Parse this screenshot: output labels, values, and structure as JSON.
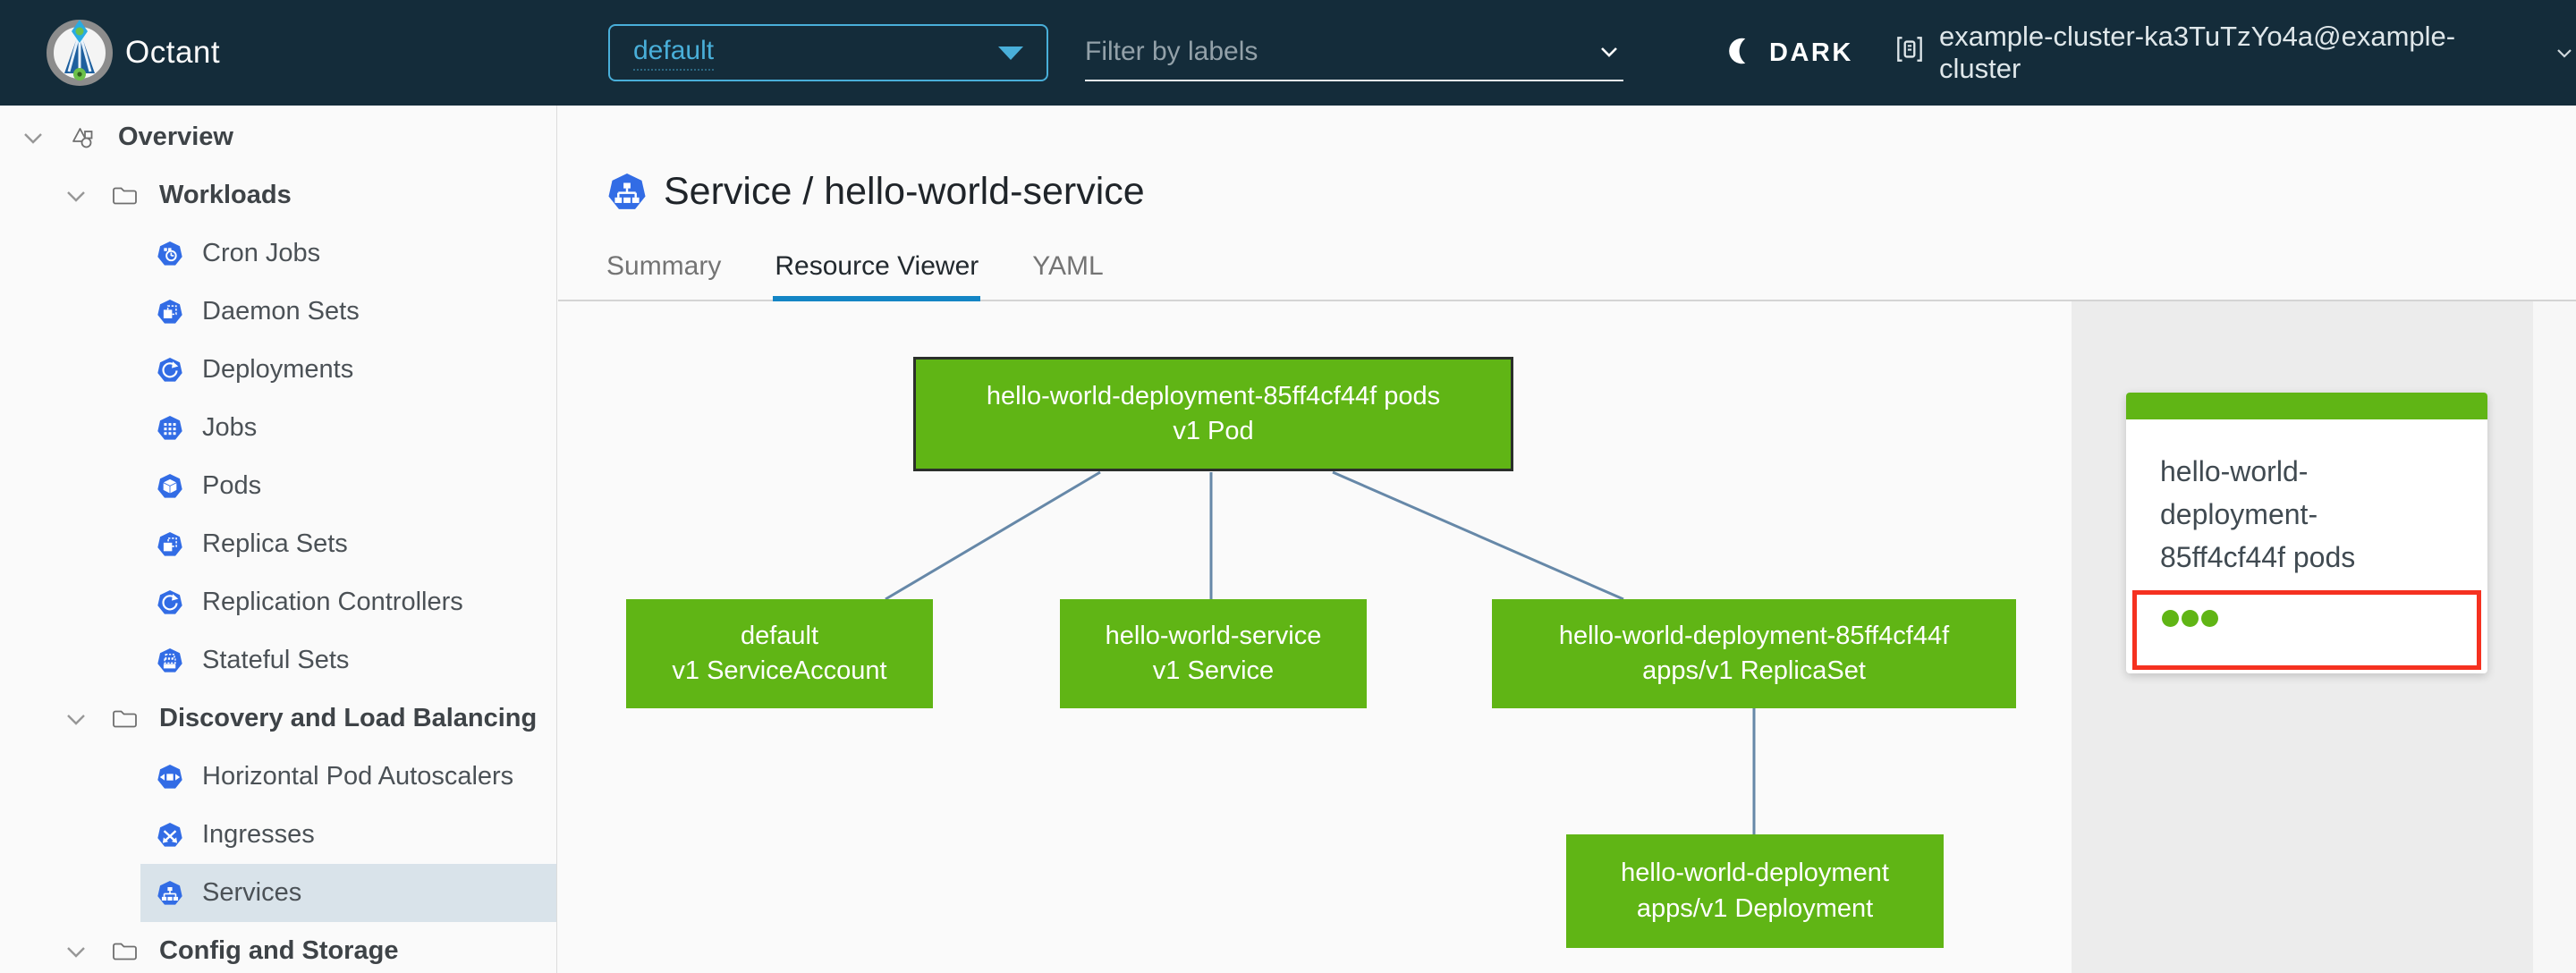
{
  "topbar": {
    "app_name": "Octant",
    "namespace_selector": {
      "value": "default",
      "icon": "caret-down-icon"
    },
    "filter_input": {
      "placeholder": "Filter by labels",
      "icon": "chevron-down-icon"
    },
    "theme_toggle": {
      "label": "DARK",
      "icon": "moon-icon"
    },
    "context_switcher": {
      "label": "example-cluster-ka3TuTzYo4a@example-cluster",
      "icon": "cluster-icon",
      "chevron": "chevron-down-icon"
    }
  },
  "sidebar": {
    "items": [
      {
        "label": "Overview",
        "kind": "group",
        "level": 0,
        "icon": "objects-icon",
        "chevron": true,
        "selected": false
      },
      {
        "label": "Workloads",
        "kind": "group",
        "level": 1,
        "icon": "folder-icon",
        "chevron": true,
        "selected": false
      },
      {
        "label": "Cron Jobs",
        "kind": "leaf",
        "icon": "cronjob-icon",
        "selected": false
      },
      {
        "label": "Daemon Sets",
        "kind": "leaf",
        "icon": "daemonset-icon",
        "selected": false
      },
      {
        "label": "Deployments",
        "kind": "leaf",
        "icon": "deployment-icon",
        "selected": false
      },
      {
        "label": "Jobs",
        "kind": "leaf",
        "icon": "job-icon",
        "selected": false
      },
      {
        "label": "Pods",
        "kind": "leaf",
        "icon": "pod-icon",
        "selected": false
      },
      {
        "label": "Replica Sets",
        "kind": "leaf",
        "icon": "replicaset-icon",
        "selected": false
      },
      {
        "label": "Replication Controllers",
        "kind": "leaf",
        "icon": "replicationcontroller-icon",
        "selected": false
      },
      {
        "label": "Stateful Sets",
        "kind": "leaf",
        "icon": "statefulset-icon",
        "selected": false
      },
      {
        "label": "Discovery and Load Balancing",
        "kind": "group",
        "level": 1,
        "icon": "folder-icon",
        "chevron": true,
        "selected": false
      },
      {
        "label": "Horizontal Pod Autoscalers",
        "kind": "leaf",
        "icon": "hpa-icon",
        "selected": false
      },
      {
        "label": "Ingresses",
        "kind": "leaf",
        "icon": "ingress-icon",
        "selected": false
      },
      {
        "label": "Services",
        "kind": "leaf",
        "icon": "service-icon",
        "selected": true
      },
      {
        "label": "Config and Storage",
        "kind": "group",
        "level": 1,
        "icon": "folder-icon",
        "chevron": true,
        "selected": false
      }
    ]
  },
  "content": {
    "title": "Service / hello-world-service",
    "title_icon": "service-icon",
    "tabs": [
      {
        "label": "Summary",
        "active": false
      },
      {
        "label": "Resource Viewer",
        "active": true
      },
      {
        "label": "YAML",
        "active": false
      }
    ]
  },
  "graph": {
    "nodes": [
      {
        "name": "hello-world-deployment-85ff4cf44f pods",
        "kind": "v1 Pod",
        "selected": true
      },
      {
        "name": "default",
        "kind": "v1 ServiceAccount",
        "selected": false
      },
      {
        "name": "hello-world-service",
        "kind": "v1 Service",
        "selected": false
      },
      {
        "name": "hello-world-deployment-85ff4cf44f",
        "kind": "apps/v1 ReplicaSet",
        "selected": false
      },
      {
        "name": "hello-world-deployment",
        "kind": "apps/v1 Deployment",
        "selected": false
      }
    ]
  },
  "panel": {
    "card": {
      "title": "hello-world-deployment-85ff4cf44f pods",
      "pod_status_dot_count": 3,
      "pod_status_color": "#60b515",
      "alert_border_color": "#f53120"
    }
  },
  "colors": {
    "header_navy": "#142c3a",
    "accent_green": "#60b515",
    "k8s_blue": "#326ce5",
    "edge_blue": "#6688a8",
    "link_blue": "#49afd9",
    "active_tab_blue": "#1385c5",
    "selected_row": "#d9e3ea"
  }
}
